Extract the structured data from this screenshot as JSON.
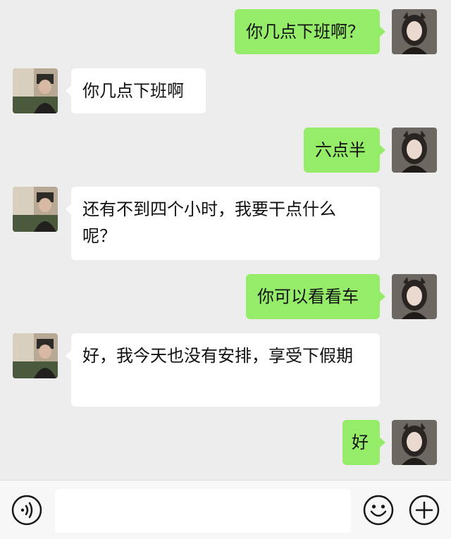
{
  "colors": {
    "background": "#ededed",
    "my_bubble": "#95ec69",
    "their_bubble": "#ffffff",
    "input_bar": "#f7f7f7"
  },
  "messages": [
    {
      "side": "me",
      "text": "你几点下班啊？"
    },
    {
      "side": "them",
      "text": "你几点下班啊"
    },
    {
      "side": "me",
      "text": "六点半"
    },
    {
      "side": "them",
      "text": "还有不到四个小时，我要干点什么呢？"
    },
    {
      "side": "me",
      "text": "你可以看看车"
    },
    {
      "side": "them",
      "text": "好，我今天也没有安排，享受下假期"
    },
    {
      "side": "me",
      "text": "好"
    }
  ],
  "input_bar": {
    "left_icon": "voice-icon",
    "text_value": "",
    "emoji_icon": "emoji-icon",
    "plus_icon": "plus-icon"
  }
}
